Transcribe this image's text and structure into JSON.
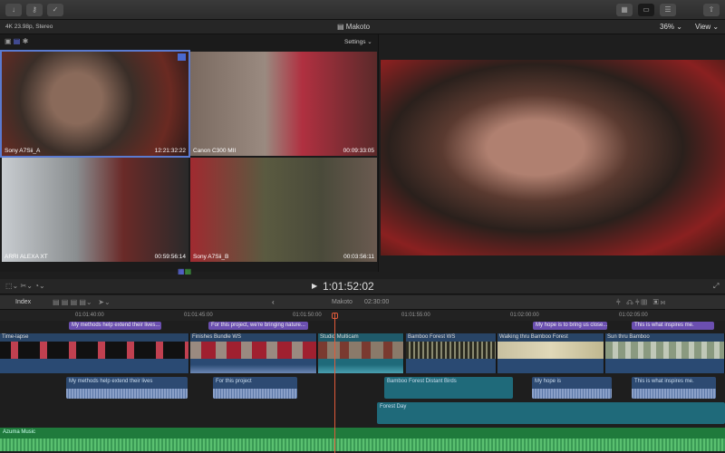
{
  "toolbar": {
    "left_icons": [
      "import-icon",
      "keyword-icon",
      "check-icon"
    ],
    "right_icons": [
      "browser-layout-icon",
      "viewer-layout-icon",
      "inspector-icon",
      "share-icon"
    ]
  },
  "infobar": {
    "format": "4K 23.98p, Stereo",
    "project": "Makoto",
    "zoom": "36%",
    "view": "View"
  },
  "angle_viewer": {
    "settings": "Settings",
    "angles": [
      {
        "name": "Sony A7Sii_A",
        "timecode": "12:21:32:22",
        "active": true
      },
      {
        "name": "Canon C300 MII",
        "timecode": "00:09:33:05"
      },
      {
        "name": "ARRI ALEXA XT",
        "timecode": "00:59:56:14"
      },
      {
        "name": "Sony A7Sii_B",
        "timecode": "00:03:56:11"
      }
    ]
  },
  "playback": {
    "timecode": "1:01:52:02"
  },
  "timeline_bar": {
    "index": "Index",
    "project": "Makoto",
    "duration": "02:30:00"
  },
  "ruler": [
    "01:01:40:00",
    "01:01:45:00",
    "01:01:50:00",
    "01:01:55:00",
    "01:02:00:00",
    "01:02:05:00"
  ],
  "captions": [
    "My methods help extend their lives...",
    "For this project, we're bringing nature...",
    "My hope is to bring us close...",
    "This is what inspires me."
  ],
  "clips": [
    "Time-lapse",
    "Finishes Bundle WS",
    "Studio Multicam",
    "Bamboo Forest WS",
    "Walking thru Bamboo Forest",
    "Sun thru Bamboo"
  ],
  "connected_audio": [
    "My methods help extend their lives",
    "For this project",
    "Bamboo Forest Distant Birds",
    "My hope is",
    "This is what inspires me."
  ],
  "forest": "Forest Day",
  "music": "Azuma Music",
  "colors": {
    "caption": "#6b4fb0",
    "clip": "#2a4a73",
    "multicam": "#1f6a7a",
    "music": "#1f7a3c",
    "playhead": "#e05a3a"
  }
}
